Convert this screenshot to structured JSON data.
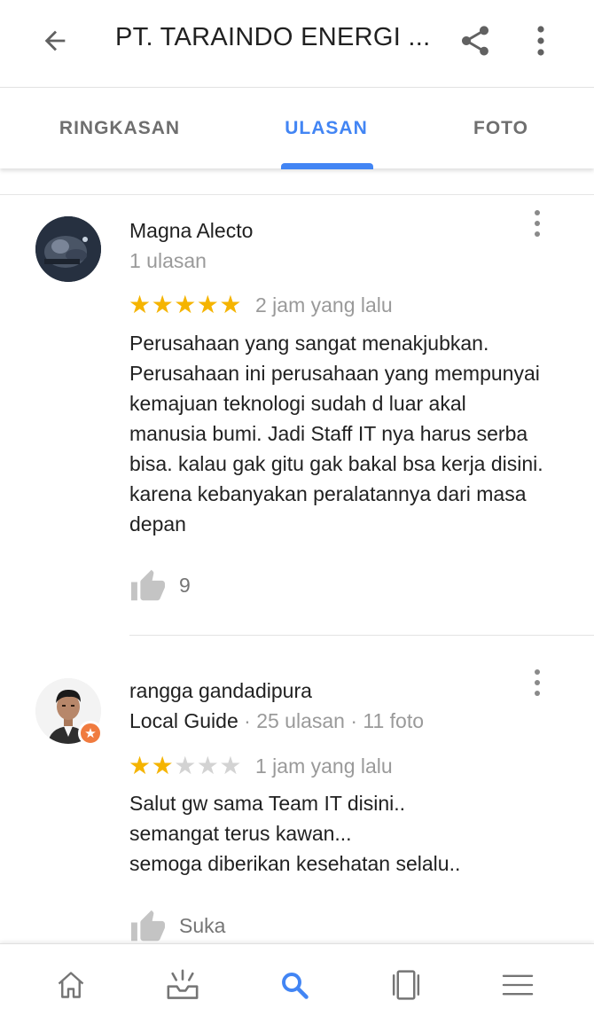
{
  "appbar": {
    "title": "PT. TARAINDO ENERGI ...",
    "back_icon": "arrow-back-icon",
    "share_icon": "share-icon",
    "more_icon": "more-vert-icon"
  },
  "tabs": [
    {
      "label": "RINGKASAN",
      "active": false
    },
    {
      "label": "ULASAN",
      "active": true
    },
    {
      "label": "FOTO",
      "active": false
    }
  ],
  "colors": {
    "accent": "#4285f4",
    "star": "#f5b400",
    "star_off": "#d3d3d3",
    "secondary_text": "#9a9a9a",
    "local_guide_badge": "#f07b3f"
  },
  "reviews": [
    {
      "author": "Magna Alecto",
      "meta": "1 ulasan",
      "rating": 5,
      "time": "2 jam yang lalu",
      "text": "Perusahaan yang sangat menakjubkan. Perusahaan ini  perusahaan yang mempunyai kemajuan teknologi sudah d luar akal manusia bumi. Jadi Staff IT nya harus serba bisa. kalau gak gitu gak bakal bsa kerja disini. karena kebanyakan peralatannya dari masa depan",
      "likes": "9"
    },
    {
      "author": "rangga gandadipura",
      "badge": "Local Guide",
      "meta": " · 25 ulasan · 11 foto",
      "rating": 2,
      "time": "1 jam yang lalu",
      "text_lines": [
        "Salut gw sama Team IT disini..",
        "semangat terus kawan...",
        "semoga diberikan kesehatan selalu.."
      ],
      "likes": "Suka"
    }
  ],
  "bottom_nav": [
    {
      "icon": "home-icon",
      "active": false
    },
    {
      "icon": "inbox-updates-icon",
      "active": false
    },
    {
      "icon": "search-icon",
      "active": true
    },
    {
      "icon": "saved-cards-icon",
      "active": false
    },
    {
      "icon": "menu-icon",
      "active": false
    }
  ]
}
